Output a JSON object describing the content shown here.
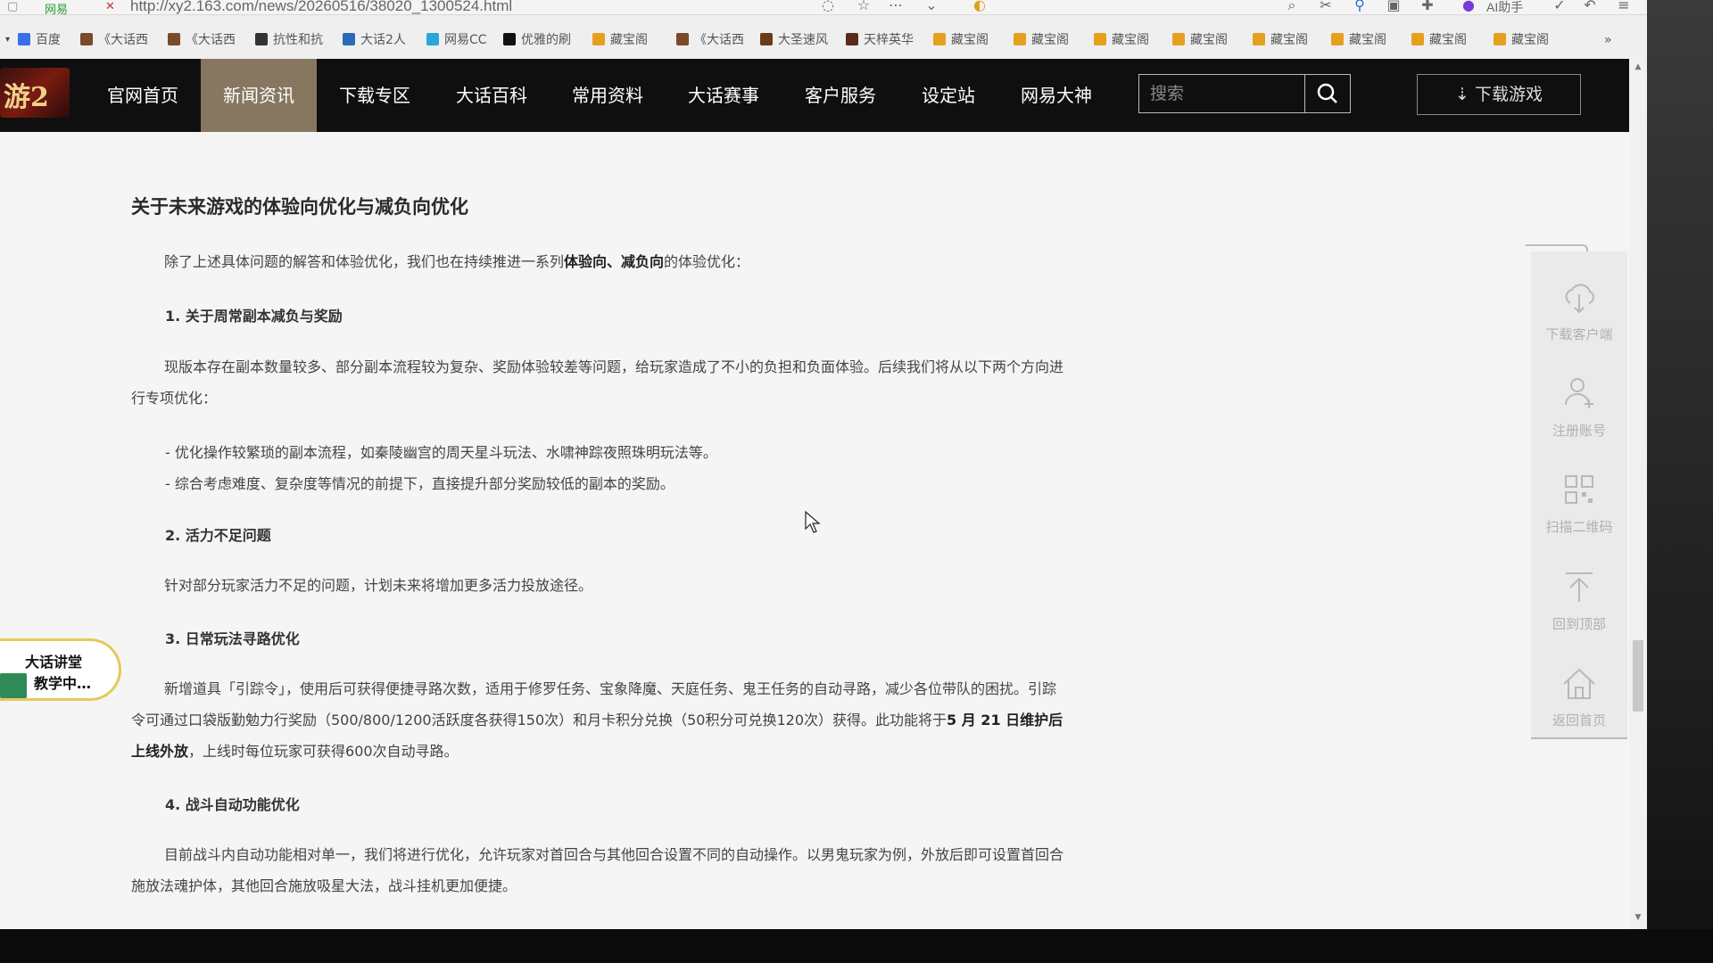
{
  "browser": {
    "url": "http://xy2.163.com/news/20260516/38020_1300524.html",
    "tab_label": "网易",
    "ai_label": "AI助手",
    "bookmarks": [
      {
        "label": "百度",
        "color": "#3b6ee8"
      },
      {
        "label": "《大话西",
        "color": "#7a4a2a"
      },
      {
        "label": "《大话西",
        "color": "#7a4a2a"
      },
      {
        "label": "抗性和抗",
        "color": "#333333"
      },
      {
        "label": "大话2人",
        "color": "#2a6ab8"
      },
      {
        "label": "网易CC",
        "color": "#2aa6d8"
      },
      {
        "label": "优雅的刷",
        "color": "#111111"
      },
      {
        "label": "藏宝阁",
        "color": "#e6a020"
      },
      {
        "label": "《大话西",
        "color": "#7a4a2a"
      },
      {
        "label": "大圣速风",
        "color": "#6a3a1a"
      },
      {
        "label": "天梓英华",
        "color": "#5a2a1a"
      },
      {
        "label": "藏宝阁",
        "color": "#e6a020"
      },
      {
        "label": "藏宝阁",
        "color": "#e6a020"
      },
      {
        "label": "藏宝阁",
        "color": "#e6a020"
      },
      {
        "label": "藏宝阁",
        "color": "#e6a020"
      },
      {
        "label": "藏宝阁",
        "color": "#e6a020"
      },
      {
        "label": "藏宝阁",
        "color": "#e6a020"
      },
      {
        "label": "藏宝阁",
        "color": "#e6a020"
      },
      {
        "label": "藏宝阁",
        "color": "#e6a020"
      }
    ],
    "more": "»"
  },
  "site": {
    "logo_text": "游2",
    "nav": [
      {
        "label": "官网首页",
        "active": false
      },
      {
        "label": "新闻资讯",
        "active": true
      },
      {
        "label": "下载专区",
        "active": false
      },
      {
        "label": "大话百科",
        "active": false
      },
      {
        "label": "常用资料",
        "active": false
      },
      {
        "label": "大话赛事",
        "active": false
      },
      {
        "label": "客户服务",
        "active": false
      },
      {
        "label": "设定站",
        "active": false
      },
      {
        "label": "网易大神",
        "active": false
      }
    ],
    "search_placeholder": "搜索",
    "download_label": "下载游戏"
  },
  "article": {
    "title": "关于未来游戏的体验向优化与减负向优化",
    "intro_pre": "除了上述具体问题的解答和体验优化，我们也在持续推进一系列",
    "intro_bold": "体验向、减负向",
    "intro_post": "的体验优化：",
    "s1_title": "1. 关于周常副本减负与奖励",
    "s1_para": "现版本存在副本数量较多、部分副本流程较为复杂、奖励体验较差等问题，给玩家造成了不小的负担和负面体验。后续我们将从以下两个方向进行专项优化：",
    "s1_item1": "- 优化操作较繁琐的副本流程，如秦陵幽宫的周天星斗玩法、水啸神踪夜照珠明玩法等。",
    "s1_item2": "- 综合考虑难度、复杂度等情况的前提下，直接提升部分奖励较低的副本的奖励。",
    "s2_title": "2. 活力不足问题",
    "s2_para": "针对部分玩家活力不足的问题，计划未来将增加更多活力投放途径。",
    "s3_title": "3. 日常玩法寻路优化",
    "s3_pre": "新增道具「引踪令」，使用后可获得便捷寻路次数，适用于修罗任务、宝象降魔、天庭任务、鬼王任务的自动寻路，减少各位带队的困扰。引踪令可通过口袋版勤勉力行奖励（500/800/1200活跃度各获得150次）和月卡积分兑换（50积分可兑换120次）获得。此功能将于",
    "s3_bold": "5 月 21 日维护后上线外放",
    "s3_post": "，上线时每位玩家可获得600次自动寻路。",
    "s4_title": "4. 战斗自动功能优化",
    "s4_para": "目前战斗内自动功能相对单一，我们将进行优化，允许玩家对首回合与其他回合设置不同的自动操作。以男鬼玩家为例，外放后即可设置首回合施放法魂护体，其他回合施放吸星大法，战斗挂机更加便捷。"
  },
  "side": [
    {
      "label": "下载客户端",
      "icon": "cloud-download-icon"
    },
    {
      "label": "注册账号",
      "icon": "user-add-icon"
    },
    {
      "label": "扫描二维码",
      "icon": "qrcode-icon"
    },
    {
      "label": "回到顶部",
      "icon": "arrow-up-icon"
    },
    {
      "label": "返回首页",
      "icon": "home-icon"
    }
  ],
  "badge": {
    "line1": "大话讲堂",
    "line2": "教学中…"
  },
  "colors": {
    "nav_active": "#877761",
    "header_bg": "#0f0f0f",
    "badge_border": "#e6c95a"
  }
}
